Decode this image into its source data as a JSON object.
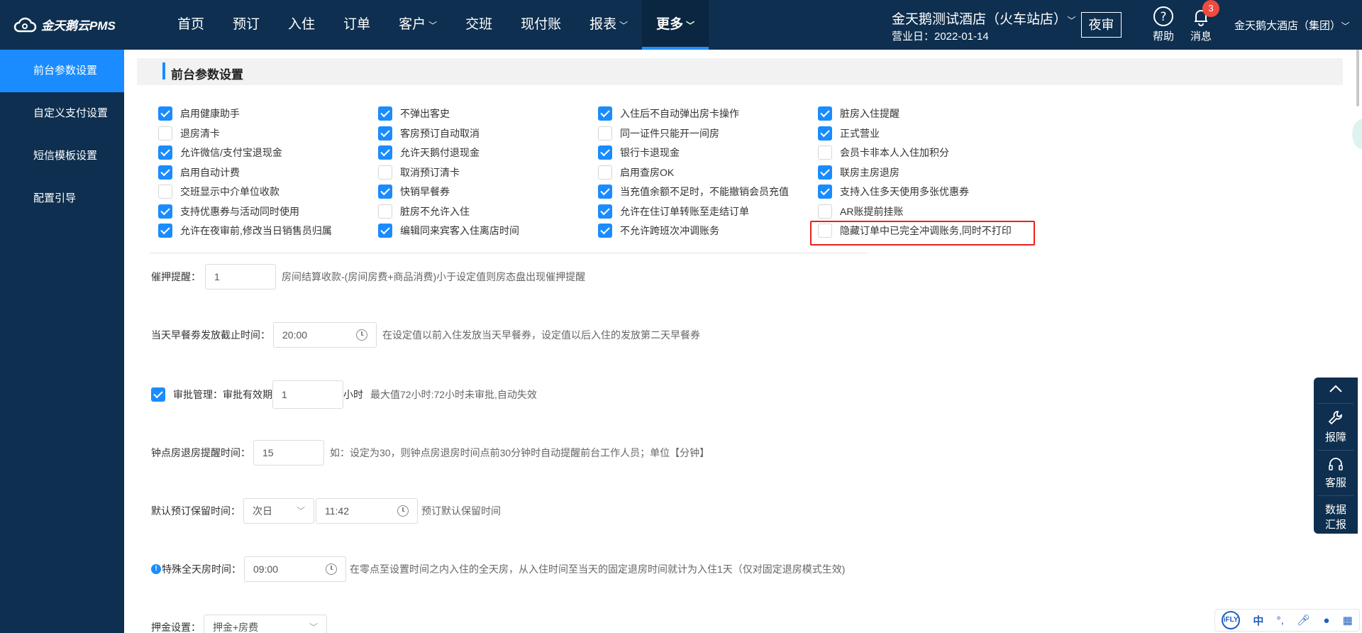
{
  "app": {
    "logo_text": "金天鹅云PMS"
  },
  "nav": [
    {
      "label": "首页",
      "dropdown": false
    },
    {
      "label": "预订",
      "dropdown": false
    },
    {
      "label": "入住",
      "dropdown": false
    },
    {
      "label": "订单",
      "dropdown": false
    },
    {
      "label": "客户",
      "dropdown": true
    },
    {
      "label": "交班",
      "dropdown": false
    },
    {
      "label": "现付账",
      "dropdown": false
    },
    {
      "label": "报表",
      "dropdown": true
    },
    {
      "label": "更多",
      "dropdown": true
    }
  ],
  "header": {
    "hotel_name": "金天鹅测试酒店（火车站店）",
    "business_date": "营业日：2022-01-14",
    "night_audit": "夜审",
    "help": "帮助",
    "messages": "消息",
    "message_count": "3",
    "group_name": "金天鹅大酒店（集团）"
  },
  "sidebar": {
    "items": [
      {
        "label": "前台参数设置",
        "active": true
      },
      {
        "label": "自定义支付设置",
        "active": false
      },
      {
        "label": "短信模板设置",
        "active": false
      },
      {
        "label": "配置引导",
        "active": false
      }
    ]
  },
  "section": {
    "title": "前台参数设置"
  },
  "checkboxes": [
    {
      "label": "启用健康助手",
      "checked": true
    },
    {
      "label": "不弹出客史",
      "checked": true
    },
    {
      "label": "入住后不自动弹出房卡操作",
      "checked": true
    },
    {
      "label": "脏房入住提醒",
      "checked": true
    },
    {
      "label": "退房清卡",
      "checked": false
    },
    {
      "label": "客房预订自动取消",
      "checked": true
    },
    {
      "label": "同一证件只能开一间房",
      "checked": false
    },
    {
      "label": "正式营业",
      "checked": true
    },
    {
      "label": "允许微信/支付宝退现金",
      "checked": true
    },
    {
      "label": "允许天鹅付退现金",
      "checked": true
    },
    {
      "label": "银行卡退现金",
      "checked": true
    },
    {
      "label": "会员卡非本人入住加积分",
      "checked": false
    },
    {
      "label": "启用自动计费",
      "checked": true
    },
    {
      "label": "取消预订清卡",
      "checked": false
    },
    {
      "label": "启用查房OK",
      "checked": false
    },
    {
      "label": "联房主房退房",
      "checked": true
    },
    {
      "label": "交班显示中介单位收款",
      "checked": false
    },
    {
      "label": "快销早餐券",
      "checked": true
    },
    {
      "label": "当充值余额不足时，不能撤销会员充值",
      "checked": true
    },
    {
      "label": "支持入住多天使用多张优惠券",
      "checked": true
    },
    {
      "label": "支持优惠券与活动同时使用",
      "checked": true
    },
    {
      "label": "脏房不允许入住",
      "checked": false
    },
    {
      "label": "允许在住订单转账至走结订单",
      "checked": true
    },
    {
      "label": "AR账提前挂账",
      "checked": false
    },
    {
      "label": "允许在夜审前,修改当日销售员归属",
      "checked": true
    },
    {
      "label": "编辑同来宾客入住离店时间",
      "checked": true
    },
    {
      "label": "不允许跨班次冲调账务",
      "checked": true
    },
    {
      "label": "隐藏订单中已完全冲调账务,同时不打印",
      "checked": false
    }
  ],
  "settings": {
    "deposit_reminder": {
      "label": "催押提醒：",
      "value": "1",
      "hint": "房间结算收款-(房间房费+商品消费)小于设定值则房态盘出现催押提醒"
    },
    "breakfast_cutoff": {
      "label": "当天早餐劵发放截止时间：",
      "value": "20:00",
      "hint": "在设定值以前入住发放当天早餐券，设定值以后入住的发放第二天早餐券"
    },
    "approval": {
      "checked": true,
      "label": "审批管理：",
      "validity_label": "审批有效期",
      "value": "1",
      "unit": "小时",
      "hint": "最大值72小时:72小时未审批,自动失效"
    },
    "hourly_checkout": {
      "label": "钟点房退房提醒时间：",
      "value": "15",
      "hint": "如：设定为30，则钟点房退房时间点前30分钟时自动提醒前台工作人员；单位【分钟】"
    },
    "reservation_hold": {
      "label": "默认预订保留时间：",
      "day_value": "次日",
      "time_value": "11:42",
      "hint": "预订默认保留时间"
    },
    "special_allday": {
      "label": "特殊全天房时间：",
      "value": "09:00",
      "hint": "在零点至设置时间之内入住的全天房，从入住时间至当天的固定退房时间就计为入住1天（仅对固定退房模式生效)"
    },
    "deposit": {
      "label": "押金设置：",
      "value": "押金+房费"
    }
  },
  "float_tool": {
    "report": "报障",
    "service": "客服",
    "data_report_1": "数据",
    "data_report_2": "汇报"
  },
  "ime": {
    "brand": "iFLY",
    "lang": "中"
  },
  "colors": {
    "nav_bg": "#0e2f4f",
    "accent": "#1a8cff",
    "highlight": "#e8211f",
    "badge": "#f04a3e"
  }
}
